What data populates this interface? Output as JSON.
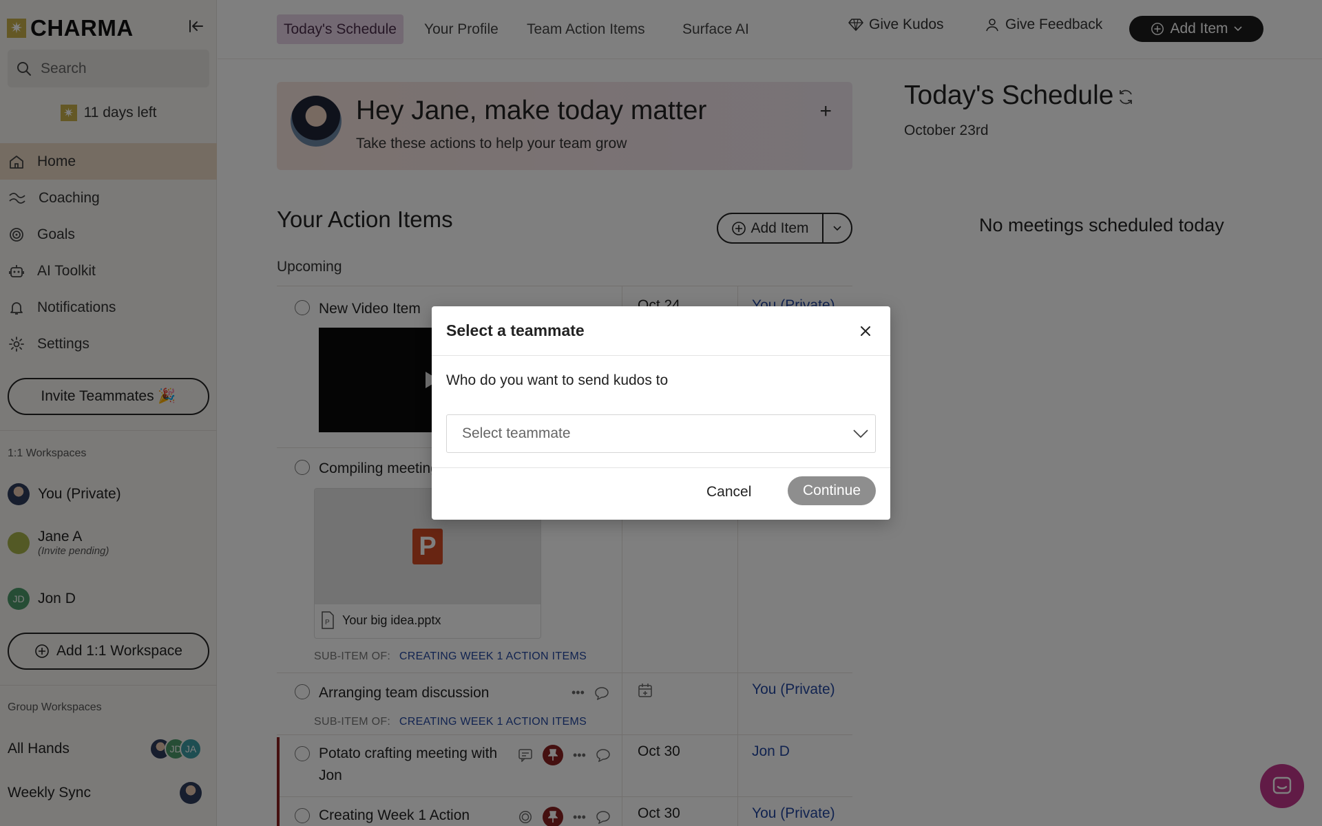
{
  "app": {
    "brand": "CHARMA"
  },
  "sidebar": {
    "search_placeholder": "Search",
    "trial_text": "11 days left",
    "nav": [
      {
        "label": "Home",
        "icon": "home-icon",
        "active": true
      },
      {
        "label": "Coaching",
        "icon": "coaching-icon"
      },
      {
        "label": "Goals",
        "icon": "target-icon"
      },
      {
        "label": "AI Toolkit",
        "icon": "robot-icon"
      },
      {
        "label": "Notifications",
        "icon": "bell-icon"
      },
      {
        "label": "Settings",
        "icon": "gear-icon"
      }
    ],
    "invite_label": "Invite Teammates 🎉",
    "one_on_one_label": "1:1 Workspaces",
    "workspaces": [
      {
        "name": "You (Private)"
      },
      {
        "name": "Jane A",
        "sub": "(Invite pending)"
      },
      {
        "name": "Jon D",
        "initials": "JD"
      }
    ],
    "add_workspace_label": "Add 1:1 Workspace",
    "group_label": "Group Workspaces",
    "groups": [
      {
        "name": "All Hands",
        "avatars": [
          "",
          "JD",
          "JA"
        ]
      },
      {
        "name": "Weekly Sync"
      }
    ]
  },
  "topnav": {
    "tabs": [
      "Today's Schedule",
      "Your Profile",
      "Team Action Items",
      "Surface AI"
    ],
    "give_kudos": "Give Kudos",
    "give_feedback": "Give Feedback",
    "add_item": "Add Item"
  },
  "hero": {
    "title": "Hey Jane, make today matter",
    "subtitle": "Take these actions to help your team grow",
    "plus": "+"
  },
  "actions": {
    "title": "Your Action Items",
    "add_item": "Add Item",
    "upcoming": "Upcoming",
    "rows": [
      {
        "title": "New Video Item",
        "due": "Oct 24",
        "owner": "You (Private)"
      },
      {
        "title": "Compiling meeting notes",
        "attachment": "Your big idea.pptx",
        "sub_of_label": "SUB-ITEM OF:",
        "sub_of": "CREATING WEEK 1 ACTION ITEMS"
      },
      {
        "title": "Arranging team discussion",
        "owner": "You (Private)",
        "sub_of_label": "SUB-ITEM OF:",
        "sub_of": "CREATING WEEK 1 ACTION ITEMS"
      },
      {
        "title": "Potato crafting meeting with Jon",
        "due": "Oct 30",
        "owner": "Jon D"
      },
      {
        "title": "Creating Week 1 Action",
        "due": "Oct 30",
        "owner": "You (Private)"
      }
    ]
  },
  "schedule": {
    "title": "Today's Schedule",
    "date": "October 23rd",
    "empty": "No meetings scheduled today"
  },
  "modal": {
    "title": "Select a teammate",
    "question": "Who do you want to send kudos to",
    "select_placeholder": "Select teammate",
    "cancel": "Cancel",
    "continue": "Continue"
  },
  "colors": {
    "active_tab": "#e7d2e7",
    "active_nav": "#ead9c5",
    "link": "#2347a0",
    "pin": "#8a2020",
    "chat": "#c2378c"
  }
}
